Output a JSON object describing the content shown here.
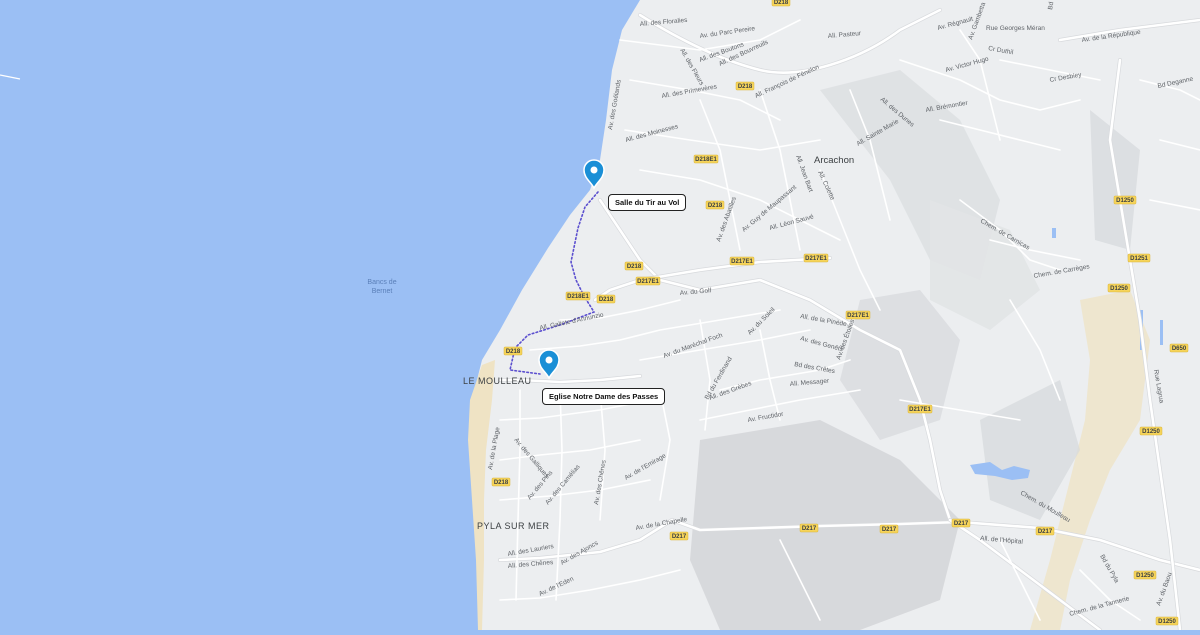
{
  "map": {
    "colors": {
      "water": "#9bbff4",
      "land": "#eceef0",
      "hills": "#d7d9dc",
      "sand": "#efe3c4",
      "road": "#ffffff",
      "route": "#5b4fcf",
      "marker": "#1a8fd6",
      "shield": "#f6d45a"
    },
    "places": {
      "le_moulleau": "LE MOULLEAU",
      "pyla_sur_mer": "PYLA SUR MER",
      "arcachon": "Arcachon",
      "bancs": [
        "Bancs de",
        "Bernet"
      ]
    },
    "markers": [
      {
        "icon": "location-pin-icon",
        "label": "Salle du Tir au Vol"
      },
      {
        "icon": "location-pin-icon",
        "label": "Eglise Notre Dame des Passes"
      }
    ],
    "route_icon": "dotted-route-line",
    "shields": [
      "D218",
      "D218",
      "D218E1",
      "D218",
      "D218",
      "D217E1",
      "D218E1",
      "D218",
      "D218",
      "D217E1",
      "D217E1",
      "D217E1",
      "D217E1",
      "D218",
      "D217",
      "D217",
      "D217",
      "D217",
      "D217",
      "D1250",
      "D1250",
      "D1250",
      "D1250",
      "D1250",
      "D1251",
      "D650"
    ],
    "streets": [
      "Av. du Parc Pereire",
      "All. des Floralies",
      "All. des Fleurs",
      "All. des Boutons",
      "All. des Bouvreuils",
      "All. des Primevères",
      "All. François de Fénelon",
      "Av. des Goélands",
      "All. des Moinesses",
      "All. des Dunes",
      "Av. de la République",
      "Cr Desbiey",
      "Bd Deganne",
      "Av. Victor Hugo",
      "Av. Gambetta",
      "Av. Régnault",
      "Rue Georges Méran",
      "Cr Duthil",
      "Bd Deganne",
      "All. Pasteur",
      "All. Sainte Marie",
      "All. Brémontier",
      "Av. des Abatilles",
      "Av. Guy de Maupassant",
      "All. Jean Bart",
      "All. Colette",
      "All. Léon Sauvé",
      "Av. du Golf",
      "All. Galiote d'Annunzio",
      "Av. du Maréchal Foch",
      "Bd du Ferdinand",
      "Av. des Goélands",
      "Av. du Soleil",
      "All. de la Pinède",
      "Av. des Genêts",
      "Av. des Étoiles",
      "Bd des Crêtes",
      "All. Messager",
      "Av. Fructidor",
      "All. des Grèbes",
      "Av. de la Plage",
      "Av. des Galliques",
      "Av. des Pins",
      "Av. des Chênes",
      "Av. des Camélias",
      "Av. de l'Emirage",
      "All. des Lauriers",
      "All. des Chênes",
      "Av. des Ajoncs",
      "Av. de l'Eden",
      "Av. de la Chapelle",
      "Chem. de Carnicas",
      "Chem. de Carrèges",
      "Rue Lagrua",
      "Bd du Pyla",
      "Chem. du Moulleau",
      "All. de l'Hôpital",
      "Chem. de la Tannerie",
      "Av. du Baou",
      "Rue Lagrua"
    ]
  }
}
